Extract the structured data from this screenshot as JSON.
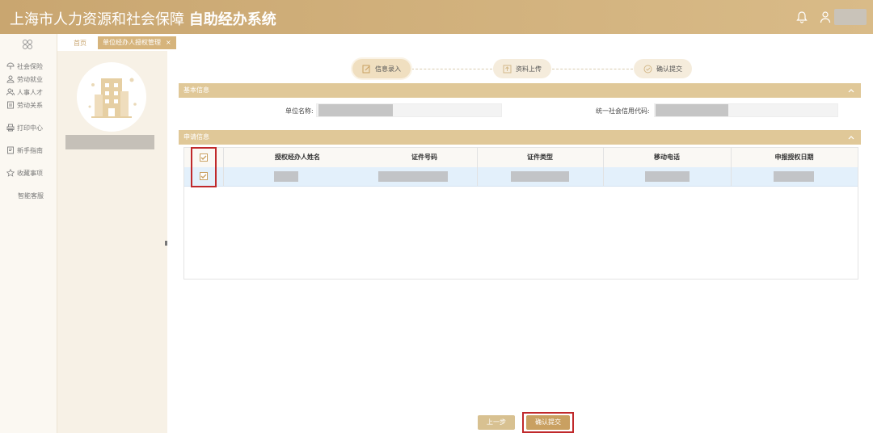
{
  "header": {
    "title_normal": "上海市人力资源和社会保障",
    "title_bold": "自助经办系统",
    "icons": [
      "bell-icon",
      "user-icon"
    ]
  },
  "sidebar": {
    "items": [
      {
        "label": "社会保险",
        "icon": "umbrella-icon"
      },
      {
        "label": "劳动就业",
        "icon": "person-icon"
      },
      {
        "label": "人事人才",
        "icon": "people-icon"
      },
      {
        "label": "劳动关系",
        "icon": "document-icon"
      },
      {
        "label": "打印中心",
        "icon": "printer-icon"
      },
      {
        "label": "新手指南",
        "icon": "guide-icon"
      },
      {
        "label": "收藏事项",
        "icon": "star-icon"
      },
      {
        "label": "智能客服",
        "icon": ""
      }
    ]
  },
  "tabs": {
    "home": "首页",
    "active": "单位经办人授权管理",
    "close": "×"
  },
  "steps": [
    {
      "label": "信息录入",
      "icon": "edit-icon"
    },
    {
      "label": "资料上传",
      "icon": "upload-icon"
    },
    {
      "label": "确认提交",
      "icon": "check-icon"
    }
  ],
  "basic_info": {
    "title": "基本信息",
    "unit_name_label": "单位名称:",
    "credit_code_label": "统一社会信用代码:"
  },
  "apply_info": {
    "title": "申请信息",
    "columns": [
      "授权经办人姓名",
      "证件号码",
      "证件类型",
      "移动电话",
      "申报授权日期"
    ]
  },
  "buttons": {
    "prev": "上一步",
    "confirm": "确认提交"
  },
  "colors": {
    "header": "#c9a670",
    "section": "#e0c898",
    "selected_row": "#e3f0fb",
    "highlight": "#c0292b"
  }
}
